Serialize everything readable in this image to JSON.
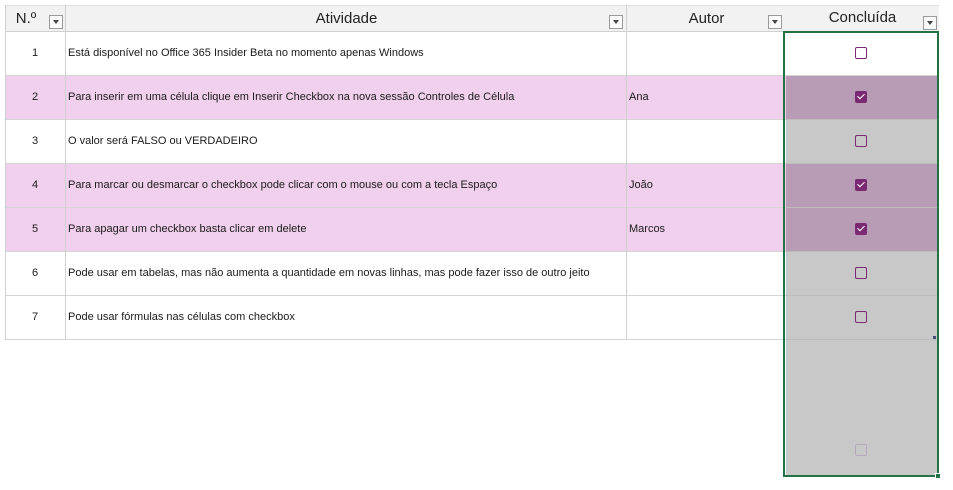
{
  "table": {
    "headers": {
      "num": "N.º",
      "activity": "Atividade",
      "author": "Autor",
      "done": "Concluída"
    },
    "rows": [
      {
        "num": "1",
        "activity": "Está disponível no Office 365 Insider Beta no momento apenas Windows",
        "author": "",
        "done": false
      },
      {
        "num": "2",
        "activity": "Para inserir em uma célula clique em Inserir Checkbox na nova sessão Controles de Célula",
        "author": "Ana",
        "done": true
      },
      {
        "num": "3",
        "activity": "O valor será FALSO ou VERDADEIRO",
        "author": "",
        "done": false
      },
      {
        "num": "4",
        "activity": "Para marcar ou desmarcar o checkbox pode clicar com o mouse ou com a tecla Espaço",
        "author": "João",
        "done": true
      },
      {
        "num": "5",
        "activity": "Para apagar um checkbox basta clicar em delete",
        "author": "Marcos",
        "done": true
      },
      {
        "num": "6",
        "activity": "Pode usar em tabelas, mas não aumenta a quantidade em novas linhas, mas pode fazer isso de outro jeito",
        "author": "",
        "done": false
      },
      {
        "num": "7",
        "activity": "Pode usar fórmulas nas células com checkbox",
        "author": "",
        "done": false
      }
    ]
  },
  "colors": {
    "row_highlight": "#f1d0ee",
    "done_highlight": "#b89cb5",
    "done_gray": "#c8c8c8",
    "checkbox": "#7a2a72",
    "selection": "#217346"
  }
}
